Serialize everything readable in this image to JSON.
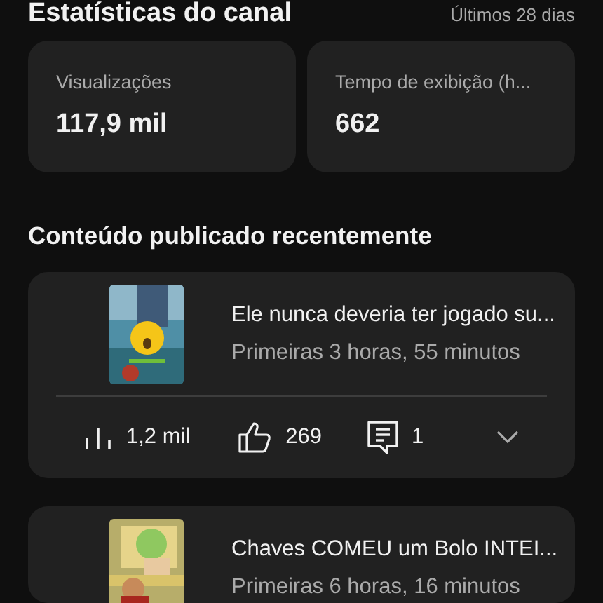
{
  "header": {
    "title": "Estatísticas do canal",
    "period": "Últimos 28 dias"
  },
  "stats": [
    {
      "label": "Visualizações",
      "value": "117,9 mil"
    },
    {
      "label": "Tempo de exibição (h...",
      "value": "662"
    }
  ],
  "section_title": "Conteúdo publicado recentemente",
  "videos": [
    {
      "kind": "picture",
      "title": "Ele nunca deveria ter jogado su...",
      "subtitle": "Primeiras 3 horas, 55 minutos",
      "expanded": false,
      "metrics": {
        "views": "1,2 mil",
        "likes": "269",
        "comments": "1"
      }
    },
    {
      "kind": "picture",
      "title": "Chaves COMEU um Bolo INTEI...",
      "subtitle": "Primeiras 6 horas, 16 minutos"
    }
  ]
}
